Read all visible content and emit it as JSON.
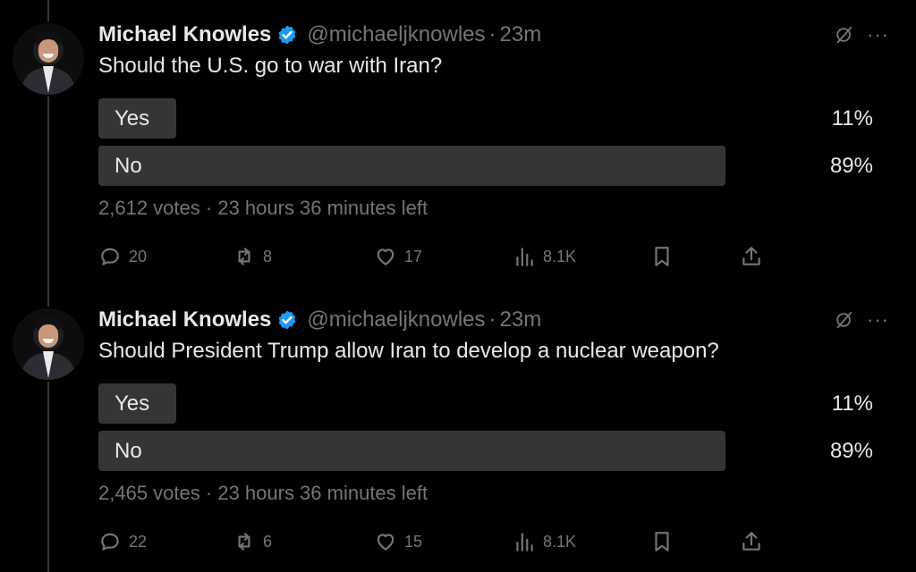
{
  "tweets": [
    {
      "author": {
        "name": "Michael Knowles",
        "handle": "@michaeljknowles",
        "time": "23m"
      },
      "question": "Should the U.S. go to war with Iran?",
      "options": [
        {
          "label": "Yes",
          "percent": "11%",
          "share": 0.11
        },
        {
          "label": "No",
          "percent": "89%",
          "share": 0.89
        }
      ],
      "votes": "2,612 votes",
      "time_left": "23 hours 36 minutes left",
      "stats": {
        "replies": "20",
        "reposts": "8",
        "likes": "17",
        "views": "8.1K"
      }
    },
    {
      "author": {
        "name": "Michael Knowles",
        "handle": "@michaeljknowles",
        "time": "23m"
      },
      "question": "Should President Trump allow Iran to develop a nuclear weapon?",
      "options": [
        {
          "label": "Yes",
          "percent": "11%",
          "share": 0.11
        },
        {
          "label": "No",
          "percent": "89%",
          "share": 0.89
        }
      ],
      "votes": "2,465 votes",
      "time_left": "23 hours 36 minutes left",
      "stats": {
        "replies": "22",
        "reposts": "6",
        "likes": "15",
        "views": "8.1K"
      }
    }
  ],
  "ui": {
    "separator": "·",
    "more_label": "···",
    "colors": {
      "background": "#000000",
      "text": "#e7e9ea",
      "muted": "#71767b",
      "poll_fill": "#333639",
      "verified": "#1d9bf0"
    },
    "icons": [
      "verified-badge-icon",
      "grok-icon",
      "more-icon",
      "reply-icon",
      "repost-icon",
      "like-icon",
      "views-icon",
      "bookmark-icon",
      "share-icon"
    ]
  }
}
